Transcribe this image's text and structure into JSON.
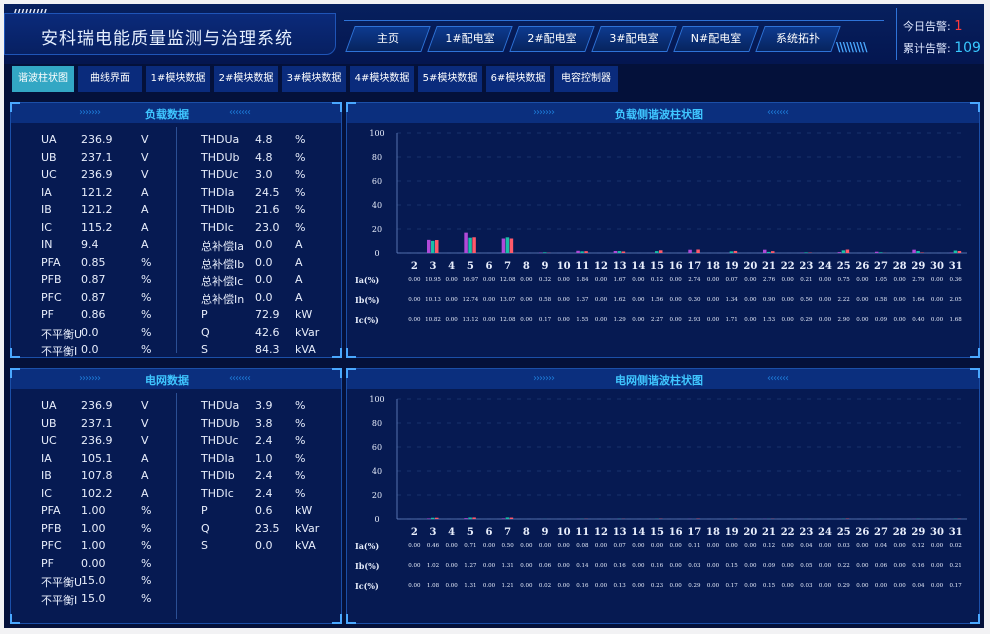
{
  "header": {
    "title": "安科瑞电能质量监测与治理系统",
    "nav_tabs": [
      "主页",
      "1#配电室",
      "2#配电室",
      "3#配电室",
      "N#配电室",
      "系统拓扑"
    ],
    "alarms": {
      "today_label": "今日告警:",
      "today_value": "1",
      "total_label": "累计告警:",
      "total_value": "109"
    }
  },
  "subnav": [
    "谐波柱状图",
    "曲线界面",
    "1#模块数据",
    "2#模块数据",
    "3#模块数据",
    "4#模块数据",
    "5#模块数据",
    "6#模块数据",
    "电容控制器"
  ],
  "load_panel": {
    "title": "负载数据",
    "left": [
      {
        "label": "UA",
        "value": "236.9",
        "unit": "V"
      },
      {
        "label": "UB",
        "value": "237.1",
        "unit": "V"
      },
      {
        "label": "UC",
        "value": "236.9",
        "unit": "V"
      },
      {
        "label": "IA",
        "value": "121.2",
        "unit": "A"
      },
      {
        "label": "IB",
        "value": "121.2",
        "unit": "A"
      },
      {
        "label": "IC",
        "value": "115.2",
        "unit": "A"
      },
      {
        "label": "IN",
        "value": "9.4",
        "unit": "A"
      },
      {
        "label": "PFA",
        "value": "0.85",
        "unit": "%"
      },
      {
        "label": "PFB",
        "value": "0.87",
        "unit": "%"
      },
      {
        "label": "PFC",
        "value": "0.87",
        "unit": "%"
      },
      {
        "label": "PF",
        "value": "0.86",
        "unit": "%"
      },
      {
        "label": "不平衡U",
        "value": "0.0",
        "unit": "%"
      },
      {
        "label": "不平衡I",
        "value": "0.0",
        "unit": "%"
      }
    ],
    "right": [
      {
        "label": "THDUa",
        "value": "4.8",
        "unit": "%"
      },
      {
        "label": "THDUb",
        "value": "4.8",
        "unit": "%"
      },
      {
        "label": "THDUc",
        "value": "3.0",
        "unit": "%"
      },
      {
        "label": "THDIa",
        "value": "24.5",
        "unit": "%"
      },
      {
        "label": "THDIb",
        "value": "21.6",
        "unit": "%"
      },
      {
        "label": "THDIc",
        "value": "23.0",
        "unit": "%"
      },
      {
        "label": "总补偿Ia",
        "value": "0.0",
        "unit": "A"
      },
      {
        "label": "总补偿Ib",
        "value": "0.0",
        "unit": "A"
      },
      {
        "label": "总补偿Ic",
        "value": "0.0",
        "unit": "A"
      },
      {
        "label": "总补偿In",
        "value": "0.0",
        "unit": "A"
      },
      {
        "label": "P",
        "value": "72.9",
        "unit": "kW"
      },
      {
        "label": "Q",
        "value": "42.6",
        "unit": "kVar"
      },
      {
        "label": "S",
        "value": "84.3",
        "unit": "kVA"
      }
    ]
  },
  "grid_panel": {
    "title": "电网数据",
    "left": [
      {
        "label": "UA",
        "value": "236.9",
        "unit": "V"
      },
      {
        "label": "UB",
        "value": "237.1",
        "unit": "V"
      },
      {
        "label": "UC",
        "value": "236.9",
        "unit": "V"
      },
      {
        "label": "IA",
        "value": "105.1",
        "unit": "A"
      },
      {
        "label": "IB",
        "value": "107.8",
        "unit": "A"
      },
      {
        "label": "IC",
        "value": "102.2",
        "unit": "A"
      },
      {
        "label": "PFA",
        "value": "1.00",
        "unit": "%"
      },
      {
        "label": "PFB",
        "value": "1.00",
        "unit": "%"
      },
      {
        "label": "PFC",
        "value": "1.00",
        "unit": "%"
      },
      {
        "label": "PF",
        "value": "0.00",
        "unit": "%"
      },
      {
        "label": "不平衡U",
        "value": "15.0",
        "unit": "%"
      },
      {
        "label": "不平衡I",
        "value": "15.0",
        "unit": "%"
      }
    ],
    "right": [
      {
        "label": "THDUa",
        "value": "3.9",
        "unit": "%"
      },
      {
        "label": "THDUb",
        "value": "3.8",
        "unit": "%"
      },
      {
        "label": "THDUc",
        "value": "2.4",
        "unit": "%"
      },
      {
        "label": "THDIa",
        "value": "1.0",
        "unit": "%"
      },
      {
        "label": "THDIb",
        "value": "2.4",
        "unit": "%"
      },
      {
        "label": "THDIc",
        "value": "2.4",
        "unit": "%"
      },
      {
        "label": "P",
        "value": "0.6",
        "unit": "kW"
      },
      {
        "label": "Q",
        "value": "23.5",
        "unit": "kVar"
      },
      {
        "label": "S",
        "value": "0.0",
        "unit": "kVA"
      }
    ]
  },
  "colors": {
    "Ia": "#b04ad8",
    "Ib": "#19c0a8",
    "Ic": "#ff5a6a",
    "accent": "#3fc6ff"
  },
  "chart_data": [
    {
      "type": "bar",
      "title": "负载侧谐波柱状图",
      "categories": [
        "2",
        "3",
        "4",
        "5",
        "6",
        "7",
        "8",
        "9",
        "10",
        "11",
        "12",
        "13",
        "14",
        "15",
        "16",
        "17",
        "18",
        "19",
        "20",
        "21",
        "22",
        "23",
        "24",
        "25",
        "26",
        "27",
        "28",
        "29",
        "30",
        "31"
      ],
      "ylim": [
        0,
        100
      ],
      "yticks": [
        0,
        20,
        40,
        60,
        80,
        100
      ],
      "series": [
        {
          "name": "Ia(%)",
          "values": [
            0.0,
            10.95,
            0.0,
            16.97,
            0.0,
            12.08,
            0.0,
            0.32,
            0.0,
            1.84,
            0.0,
            1.67,
            0.0,
            0.12,
            0.0,
            2.74,
            0.0,
            0.07,
            0.0,
            2.76,
            0.0,
            0.21,
            0.0,
            0.75,
            0.0,
            1.05,
            0.0,
            2.79,
            0.0,
            0.36
          ]
        },
        {
          "name": "Ib(%)",
          "values": [
            0.0,
            10.13,
            0.0,
            12.74,
            0.0,
            13.07,
            0.0,
            0.58,
            0.0,
            1.37,
            0.0,
            1.62,
            0.0,
            1.56,
            0.0,
            0.3,
            0.0,
            1.34,
            0.0,
            0.9,
            0.0,
            0.5,
            0.0,
            2.22,
            0.0,
            0.58,
            0.0,
            1.64,
            0.0,
            2.05
          ]
        },
        {
          "name": "Ic(%)",
          "values": [
            0.0,
            10.82,
            0.0,
            13.12,
            0.0,
            12.08,
            0.0,
            0.17,
            0.0,
            1.55,
            0.0,
            1.29,
            0.0,
            2.27,
            0.0,
            2.93,
            0.0,
            1.71,
            0.0,
            1.53,
            0.0,
            0.29,
            0.0,
            2.9,
            0.0,
            0.09,
            0.0,
            0.4,
            0.0,
            1.68
          ]
        }
      ]
    },
    {
      "type": "bar",
      "title": "电网侧谐波柱状图",
      "categories": [
        "2",
        "3",
        "4",
        "5",
        "6",
        "7",
        "8",
        "9",
        "10",
        "11",
        "12",
        "13",
        "14",
        "15",
        "16",
        "17",
        "18",
        "19",
        "20",
        "21",
        "22",
        "23",
        "24",
        "25",
        "26",
        "27",
        "28",
        "29",
        "30",
        "31"
      ],
      "ylim": [
        0,
        100
      ],
      "yticks": [
        0,
        20,
        40,
        60,
        80,
        100
      ],
      "series": [
        {
          "name": "Ia(%)",
          "values": [
            0.0,
            0.46,
            0.0,
            0.71,
            0.0,
            0.5,
            0.0,
            0.0,
            0.0,
            0.08,
            0.0,
            0.07,
            0.0,
            0.0,
            0.0,
            0.11,
            0.0,
            0.0,
            0.0,
            0.12,
            0.0,
            0.04,
            0.0,
            0.03,
            0.0,
            0.04,
            0.0,
            0.12,
            0.0,
            0.02
          ]
        },
        {
          "name": "Ib(%)",
          "values": [
            0.0,
            1.02,
            0.0,
            1.27,
            0.0,
            1.31,
            0.0,
            0.06,
            0.0,
            0.14,
            0.0,
            0.16,
            0.0,
            0.16,
            0.0,
            0.03,
            0.0,
            0.15,
            0.0,
            0.09,
            0.0,
            0.05,
            0.0,
            0.22,
            0.0,
            0.06,
            0.0,
            0.16,
            0.0,
            0.21
          ]
        },
        {
          "name": "Ic(%)",
          "values": [
            0.0,
            1.08,
            0.0,
            1.31,
            0.0,
            1.21,
            0.0,
            0.02,
            0.0,
            0.16,
            0.0,
            0.13,
            0.0,
            0.23,
            0.0,
            0.29,
            0.0,
            0.17,
            0.0,
            0.15,
            0.0,
            0.03,
            0.0,
            0.29,
            0.0,
            0.0,
            0.0,
            0.04,
            0.0,
            0.17
          ]
        }
      ]
    }
  ]
}
